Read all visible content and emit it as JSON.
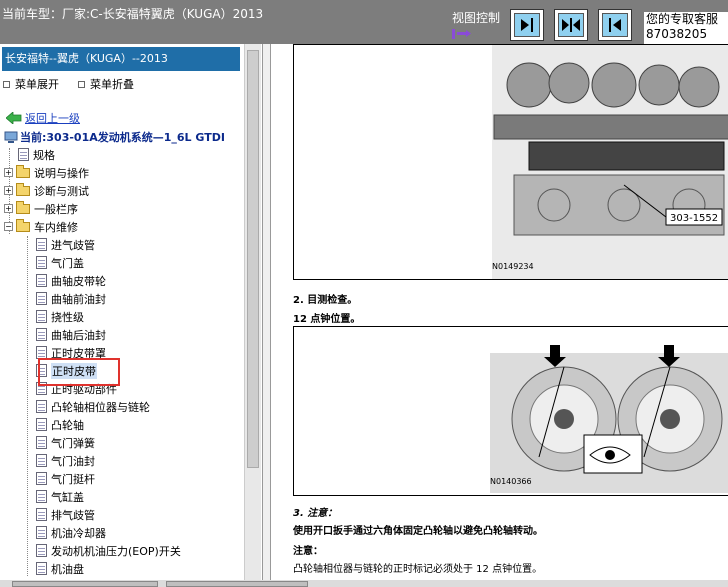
{
  "header": {
    "title": "当前车型：厂家:C-长安福特翼虎（KUGA）2013",
    "view_control_label": "视图控制",
    "support_line1": "您的专取客服",
    "support_line2": "87038205"
  },
  "sidebar": {
    "panel_title": "长安福特--翼虎（KUGA）--2013",
    "expand_label": "菜单展开",
    "collapse_label": "菜单折叠",
    "back_label": "返回上一级",
    "current_label": "当前:303-01A发动机系统—1_6L GTDI",
    "top_items": [
      {
        "label": "规格",
        "kind": "doc"
      },
      {
        "label": "说明与操作",
        "kind": "folder"
      },
      {
        "label": "诊断与测试",
        "kind": "folder"
      },
      {
        "label": "一般栏序",
        "kind": "folder"
      },
      {
        "label": "车内维修",
        "kind": "folder"
      }
    ],
    "sub_items": [
      "进气歧管",
      "气门盖",
      "曲轴皮带轮",
      "曲轴前油封",
      "挠性级",
      "曲轴后油封",
      "正时皮带罩",
      "正时皮带",
      "正时驱动部件",
      "凸轮轴相位器与链轮",
      "凸轮轴",
      "气门弹簧",
      "气门油封",
      "气门挺杆",
      "气缸盖",
      "排气歧管",
      "机油冷却器",
      "发动机机油压力(EOP)开关",
      "机油盘"
    ],
    "selected_item": "正时皮带"
  },
  "document": {
    "fig1_tool_label": "303-1552",
    "fig1_code": "N0149234",
    "step2": "2. 目测检查。",
    "step2_sub": "12 点钟位置。",
    "fig2_code": "N0140366",
    "step3": "3. 注意：",
    "step3_text": "使用开口扳手通过六角体固定凸轮轴以避免凸轮轴转动。",
    "note_label": "注意：",
    "note_text": "凸轮轴相位器与链轮的正时标记必须处于 12 点钟位置。"
  },
  "colors": {
    "header_bg": "#7d7d7d",
    "panel_title_bg": "#1f6ea8",
    "highlight_border": "#e0322d",
    "view_button_fill": "#8fd0ef"
  }
}
